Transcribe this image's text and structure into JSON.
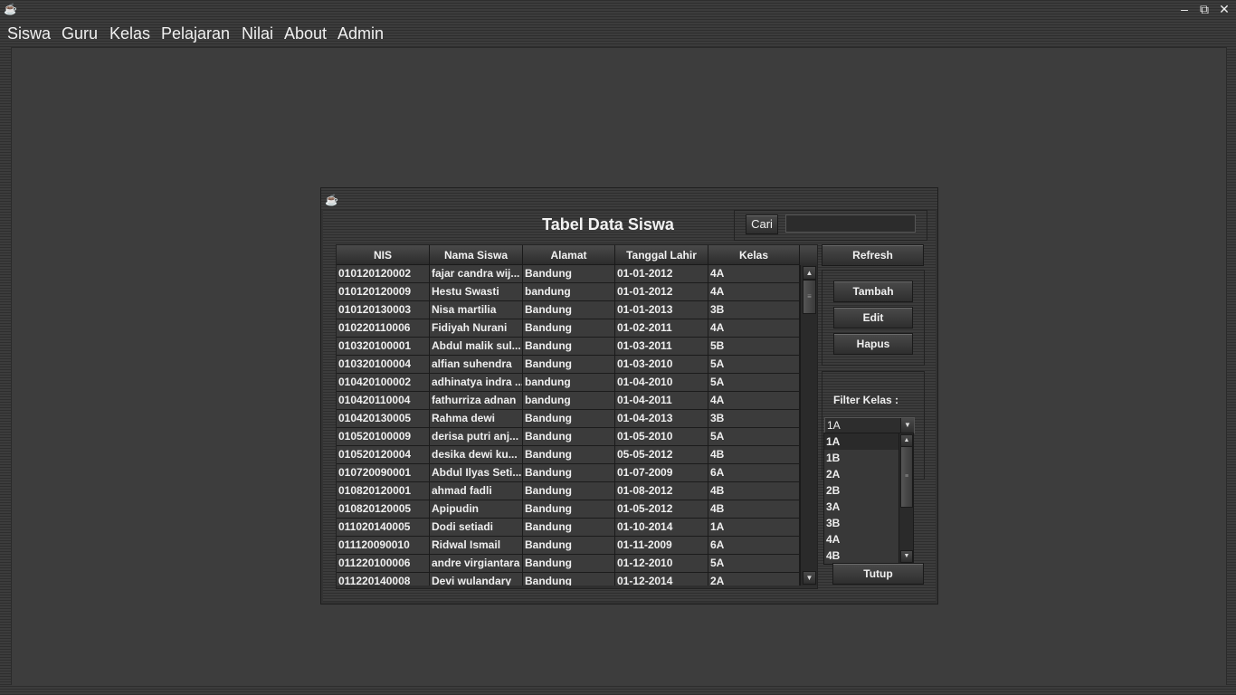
{
  "window": {
    "app_icon": "java-cup-icon",
    "controls": {
      "minimize": "–",
      "maximize": "⧉",
      "close": "✕"
    }
  },
  "menubar": {
    "items": [
      {
        "label": "Siswa"
      },
      {
        "label": "Guru"
      },
      {
        "label": "Kelas"
      },
      {
        "label": "Pelajaran"
      },
      {
        "label": "Nilai"
      },
      {
        "label": "About"
      },
      {
        "label": "Admin"
      }
    ]
  },
  "frame": {
    "icon": "java-cup-icon",
    "title": "Tabel Data Siswa",
    "search": {
      "button_label": "Cari",
      "value": ""
    },
    "table": {
      "columns": [
        "NIS",
        "Nama Siswa",
        "Alamat",
        "Tanggal Lahir",
        "Kelas"
      ],
      "rows": [
        [
          "010120120002",
          "fajar candra wij...",
          "Bandung",
          "01-01-2012",
          "4A"
        ],
        [
          "010120120009",
          "Hestu Swasti",
          "bandung",
          "01-01-2012",
          "4A"
        ],
        [
          "010120130003",
          "Nisa martilia",
          "Bandung",
          "01-01-2013",
          "3B"
        ],
        [
          "010220110006",
          "Fidiyah Nurani",
          "Bandung",
          "01-02-2011",
          "4A"
        ],
        [
          "010320100001",
          "Abdul malik sul...",
          "Bandung",
          "01-03-2011",
          "5B"
        ],
        [
          "010320100004",
          "alfian suhendra",
          "Bandung",
          "01-03-2010",
          "5A"
        ],
        [
          "010420100002",
          "adhinatya indra ...",
          "bandung",
          "01-04-2010",
          "5A"
        ],
        [
          "010420110004",
          "fathurriza adnan",
          "bandung",
          "01-04-2011",
          "4A"
        ],
        [
          "010420130005",
          "Rahma dewi",
          "Bandung",
          "01-04-2013",
          "3B"
        ],
        [
          "010520100009",
          "derisa putri anj...",
          "Bandung",
          "01-05-2010",
          "5A"
        ],
        [
          "010520120004",
          "desika dewi ku...",
          "Bandung",
          "05-05-2012",
          "4B"
        ],
        [
          "010720090001",
          "Abdul Ilyas Seti...",
          "Bandung",
          "01-07-2009",
          "6A"
        ],
        [
          "010820120001",
          "ahmad fadli",
          "Bandung",
          "01-08-2012",
          "4B"
        ],
        [
          "010820120005",
          "Apipudin",
          "Bandung",
          "01-05-2012",
          "4B"
        ],
        [
          "011020140005",
          "Dodi setiadi",
          "Bandung",
          "01-10-2014",
          "1A"
        ],
        [
          "011120090010",
          "Ridwal Ismail",
          "Bandung",
          "01-11-2009",
          "6A"
        ],
        [
          "011220100006",
          "andre virgiantara",
          "Bandung",
          "01-12-2010",
          "5A"
        ],
        [
          "011220140008",
          "Devi wulandary",
          "Bandung",
          "01-12-2014",
          "2A"
        ]
      ]
    },
    "buttons": {
      "refresh": "Refresh",
      "tambah": "Tambah",
      "edit": "Edit",
      "hapus": "Hapus",
      "tutup": "Tutup"
    },
    "filter": {
      "label": "Filter Kelas :",
      "selected": "1A",
      "options": [
        "1A",
        "1B",
        "2A",
        "2B",
        "3A",
        "3B",
        "4A",
        "4B"
      ]
    }
  }
}
